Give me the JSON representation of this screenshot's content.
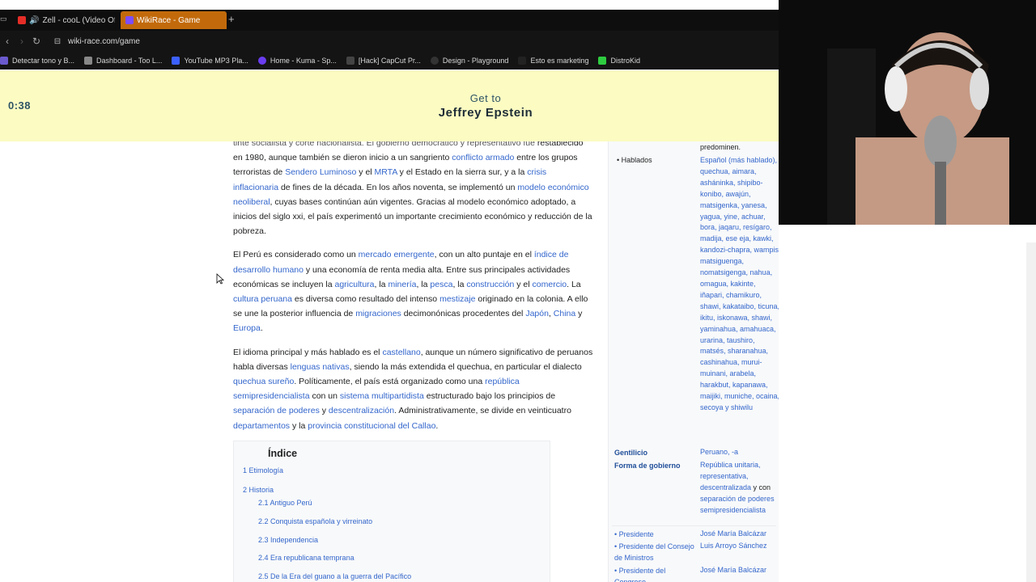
{
  "browser": {
    "tabs": [
      {
        "title": "Zell - cooL (Video Ofic",
        "active": false,
        "favicon_color": "#e52d27"
      },
      {
        "title": "WikiRace - Game",
        "active": true,
        "favicon_color": "#7c4dff"
      }
    ],
    "url": "wiki-race.com/game",
    "bookmarks": [
      {
        "label": "Detectar tono y B...",
        "color": "#6a5acd"
      },
      {
        "label": "Dashboard - Too L...",
        "color": "#888888"
      },
      {
        "label": "YouTube MP3 Pla...",
        "color": "#3c60ff"
      },
      {
        "label": "Home - Kuma - Sp...",
        "color": "#6a3df0"
      },
      {
        "label": "[Hack] CapCut Pr...",
        "color": "#444444"
      },
      {
        "label": "Design - Playground",
        "color": "#333333"
      },
      {
        "label": "Esto es marketing",
        "color": "#222222"
      },
      {
        "label": "DistroKid",
        "color": "#2ecc40"
      }
    ]
  },
  "game": {
    "timer": "0:38",
    "goal_label": "Get to",
    "goal_target": "Jeffrey Epstein"
  },
  "article": {
    "p0_top": "tinte socialista y corte nacionalista. El gobierno democrático y representativo fue",
    "p0": [
      {
        "t": "restablecido en 1980, aunque también se dieron inicio a un sangriento "
      },
      {
        "a": "conflicto armado"
      },
      {
        "t": " entre los grupos terroristas de "
      },
      {
        "a": "Sendero Luminoso"
      },
      {
        "t": " y el "
      },
      {
        "a": "MRTA"
      },
      {
        "t": " y el Estado en la sierra sur, y a la "
      },
      {
        "a": "crisis inflacionaria"
      },
      {
        "t": " de fines de la década. En los años noventa, se implementó un "
      },
      {
        "a": "modelo económico neoliberal"
      },
      {
        "t": ", cuyas bases continúan aún vigentes. Gracias al modelo económico adoptado, a inicios del siglo xxi, el país experimentó un importante crecimiento económico y reducción de la pobreza."
      }
    ],
    "p1": [
      {
        "t": "El Perú es considerado como un "
      },
      {
        "a": "mercado emergente"
      },
      {
        "t": ", con un alto puntaje en el "
      },
      {
        "a": "índice de desarrollo humano"
      },
      {
        "t": " y una economía de renta media alta. Entre sus principales actividades económicas se incluyen la "
      },
      {
        "a": "agricultura"
      },
      {
        "t": ", la "
      },
      {
        "a": "minería"
      },
      {
        "t": ", la "
      },
      {
        "a": "pesca"
      },
      {
        "t": ", la "
      },
      {
        "a": "construcción"
      },
      {
        "t": " y el "
      },
      {
        "a": "comercio"
      },
      {
        "t": ". La "
      },
      {
        "a": "cultura peruana"
      },
      {
        "t": " es diversa como resultado del intenso "
      },
      {
        "a": "mestizaje"
      },
      {
        "t": " originado en la colonia. A ello se une la posterior influencia de "
      },
      {
        "a": "migraciones"
      },
      {
        "t": " decimonónicas procedentes del "
      },
      {
        "a": "Japón"
      },
      {
        "t": ", "
      },
      {
        "a": "China"
      },
      {
        "t": " y "
      },
      {
        "a": "Europa"
      },
      {
        "t": "."
      }
    ],
    "p2": [
      {
        "t": "El idioma principal y más hablado es el "
      },
      {
        "a": "castellano"
      },
      {
        "t": ", aunque un número significativo de peruanos habla diversas "
      },
      {
        "a": "lenguas nativas"
      },
      {
        "t": ", siendo la más extendida el quechua, en particular el dialecto "
      },
      {
        "a": "quechua sureño"
      },
      {
        "t": ". Políticamente, el país está organizado como una "
      },
      {
        "a": "república semipresidencialista"
      },
      {
        "t": " con un "
      },
      {
        "a": "sistema multipartidista"
      },
      {
        "t": " estructurado bajo los principios de "
      },
      {
        "a": "separación de poderes"
      },
      {
        "t": " y "
      },
      {
        "a": "descentralización"
      },
      {
        "t": ". Administrativamente, se divide en veinticuatro "
      },
      {
        "a": "departamentos"
      },
      {
        "t": " y la "
      },
      {
        "a": "provincia constitucional del Callao"
      },
      {
        "t": "."
      }
    ]
  },
  "toc": {
    "title": "Índice",
    "items": [
      "1 Etimología",
      "2 Historia",
      "2.1 Antiguo Perú",
      "2.2 Conquista española y virreinato",
      "2.3 Independencia",
      "2.4 Era republicana temprana",
      "2.5 De la Era del guano a la guerra del Pacífico"
    ]
  },
  "infobox": {
    "predominen": "predominen.",
    "hablados_label": "• Hablados",
    "hablados_value": "Español (más hablado), quechua, aimara, asháninka, shipibo-konibo, awajún, matsigenka, yanesa, yagua, yine, achuar, bora, jaqaru, resígaro, madija, ese eja, kawki, kandozi-chapra, wampis, matsiguenga, nomatsigenga, nahua, omagua, kakinte, iñapari, chamikuro, shawi, kakataibo, ticuna, ikitu, iskonawa, shawi, yaminahua, amahuaca, urarina, taushiro, matsés, sharanahua, cashinahua, murui-muinani, arabela, harakbut, kapanawa, maijiki, muniche, ocaina, secoya y shiwilu",
    "gentilicio_label": "Gentilicio",
    "gentilicio_value": "Peruano, -a",
    "gobierno_label": "Forma de gobierno",
    "gobierno_value_a": "República unitaria, representativa, descentralizada",
    "gobierno_value_b": " y con ",
    "gobierno_value_c": "separación de poderes semipresidencialista",
    "presidente_label": "• Presidente",
    "presidente_value": "José María Balcázar",
    "consejo_label": "• Presidente del Consejo de Ministros",
    "consejo_value": "Luis Arroyo Sánchez",
    "congreso_label": "• Presidente del Congreso",
    "congreso_value": "José María Balcázar"
  }
}
